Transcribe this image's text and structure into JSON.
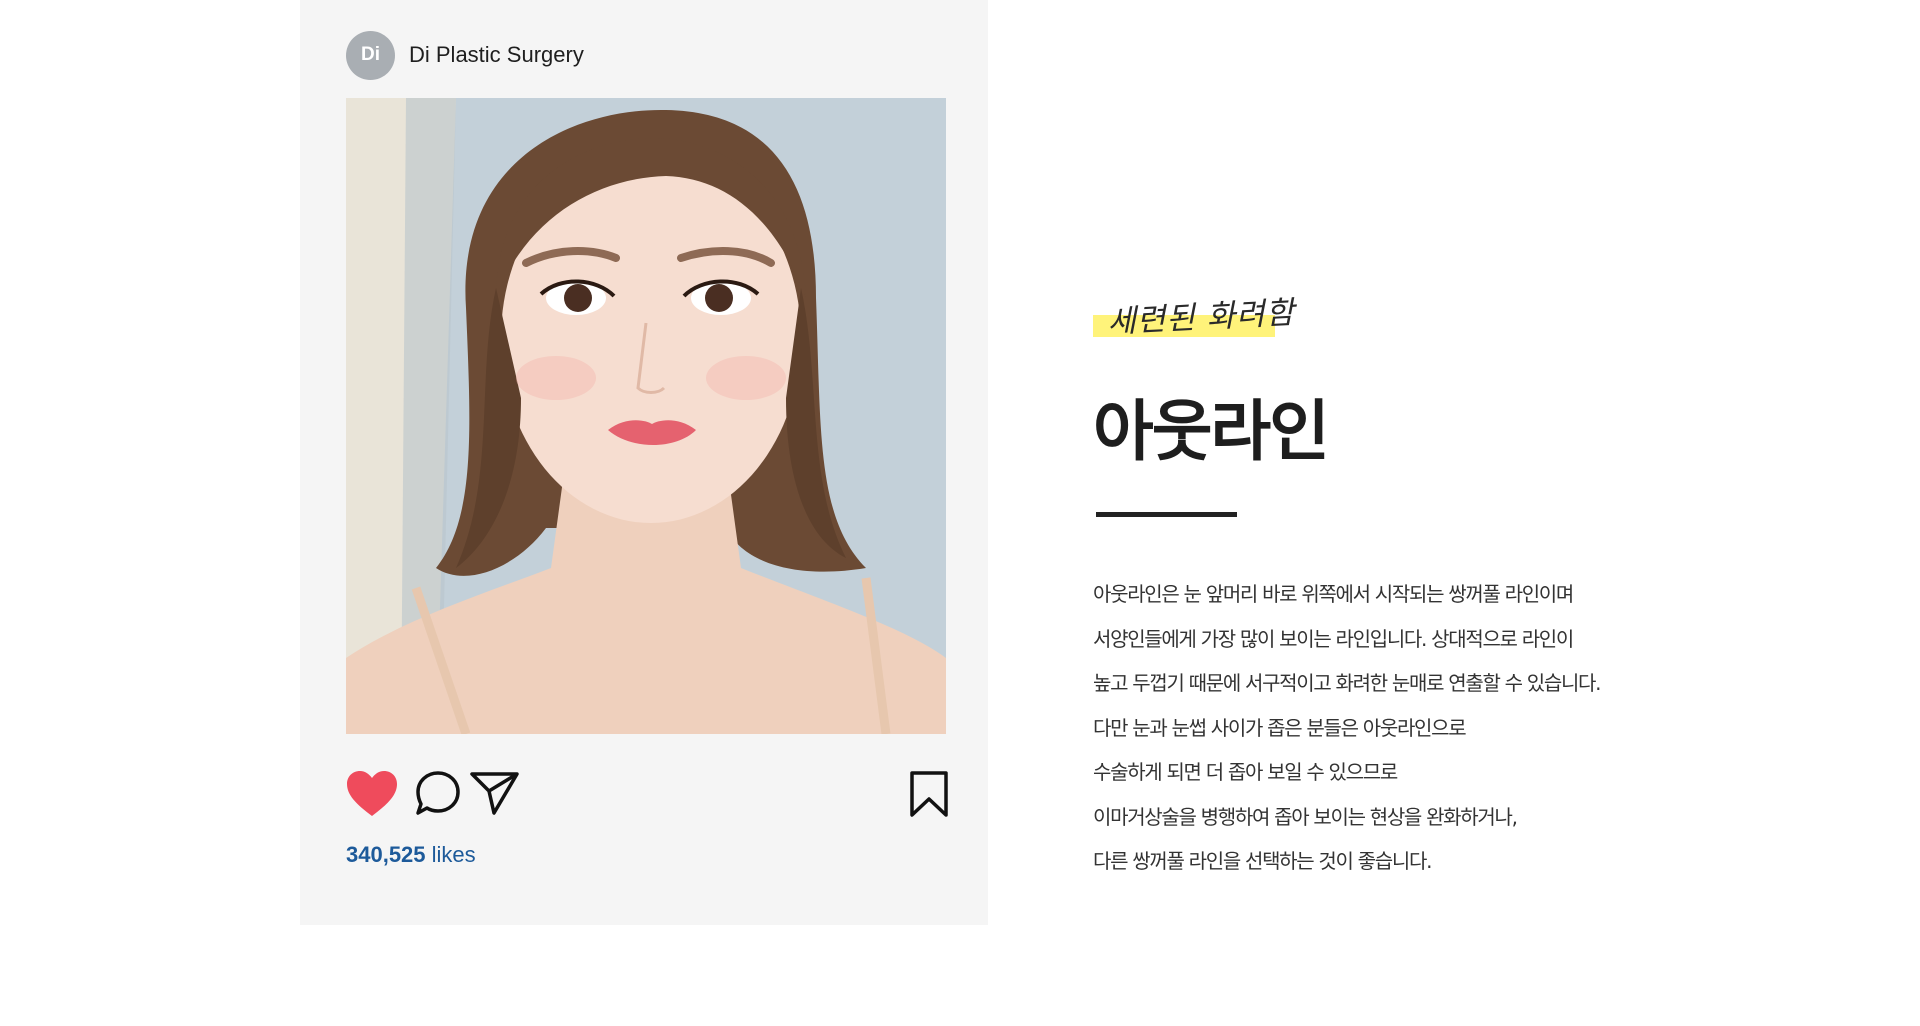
{
  "card": {
    "avatar_text": "Di",
    "account_name": "Di Plastic Surgery",
    "likes_count": "340,525",
    "likes_label": "likes",
    "icons": [
      "heart-icon",
      "comment-icon",
      "send-icon",
      "bookmark-icon"
    ],
    "colors": {
      "card_bg": "#f5f5f5",
      "heart": "#ef4b5c",
      "likes_text": "#1d5a9a",
      "avatar_bg": "#a9aeb3"
    }
  },
  "section": {
    "tagline": "세련된 화려함",
    "title": "아웃라인",
    "description_lines": [
      "아웃라인은 눈 앞머리 바로 위쪽에서 시작되는 쌍꺼풀 라인이며",
      "서양인들에게 가장 많이 보이는 라인입니다. 상대적으로 라인이",
      "높고 두껍기 때문에 서구적이고 화려한 눈매로 연출할 수 있습니다.",
      "다만 눈과 눈썹 사이가 좁은 분들은 아웃라인으로",
      "수술하게 되면 더 좁아 보일 수 있으므로",
      "이마거상술을 병행하여 좁아 보이는 현상을 완화하거나,",
      "다른 쌍꺼풀 라인을 선택하는 것이 좋습니다."
    ],
    "colors": {
      "highlight": "#fff37a",
      "title": "#1e1e1e",
      "text": "#333333"
    }
  }
}
